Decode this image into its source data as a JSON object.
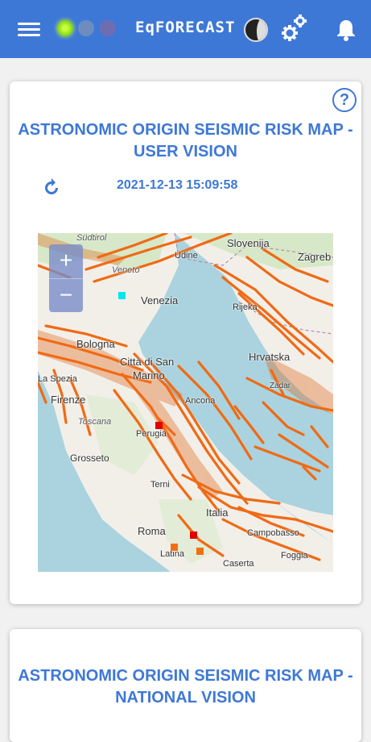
{
  "header": {
    "brand": "EqFORECAST",
    "menu_icon": "menu-icon",
    "settings_icon": "gears-icon",
    "notifications_icon": "bell-icon",
    "status_colors": [
      "#7ccf1a",
      "#6d8cc0",
      "#7a6aa8"
    ]
  },
  "user_card": {
    "title": "ASTRONOMIC ORIGIN SEISMIC RISK MAP - USER VISION",
    "help_label": "?",
    "timestamp": "2021-12-13 15:09:58",
    "map": {
      "zoom_in": "+",
      "zoom_out": "−",
      "places": [
        "Slovenija",
        "Zagreb",
        "Udine",
        "Venezia",
        "Rijeka",
        "Bologna",
        "Città di San",
        "Marino",
        "Hrvatska",
        "La Spezia",
        "Zadar",
        "Firenze",
        "Ancona",
        "Toscana",
        "Perugia",
        "Grosseto",
        "Terni",
        "Italia",
        "Roma",
        "Campobasso",
        "Latina",
        "Caserta",
        "Foggia",
        "Südtirol",
        "Veneto"
      ],
      "marker_colors": {
        "red": "#e00000",
        "orange": "#f07010",
        "cyan": "#00e5f0"
      }
    }
  },
  "national_card": {
    "title": "ASTRONOMIC ORIGIN SEISMIC RISK MAP - NATIONAL VISION"
  }
}
